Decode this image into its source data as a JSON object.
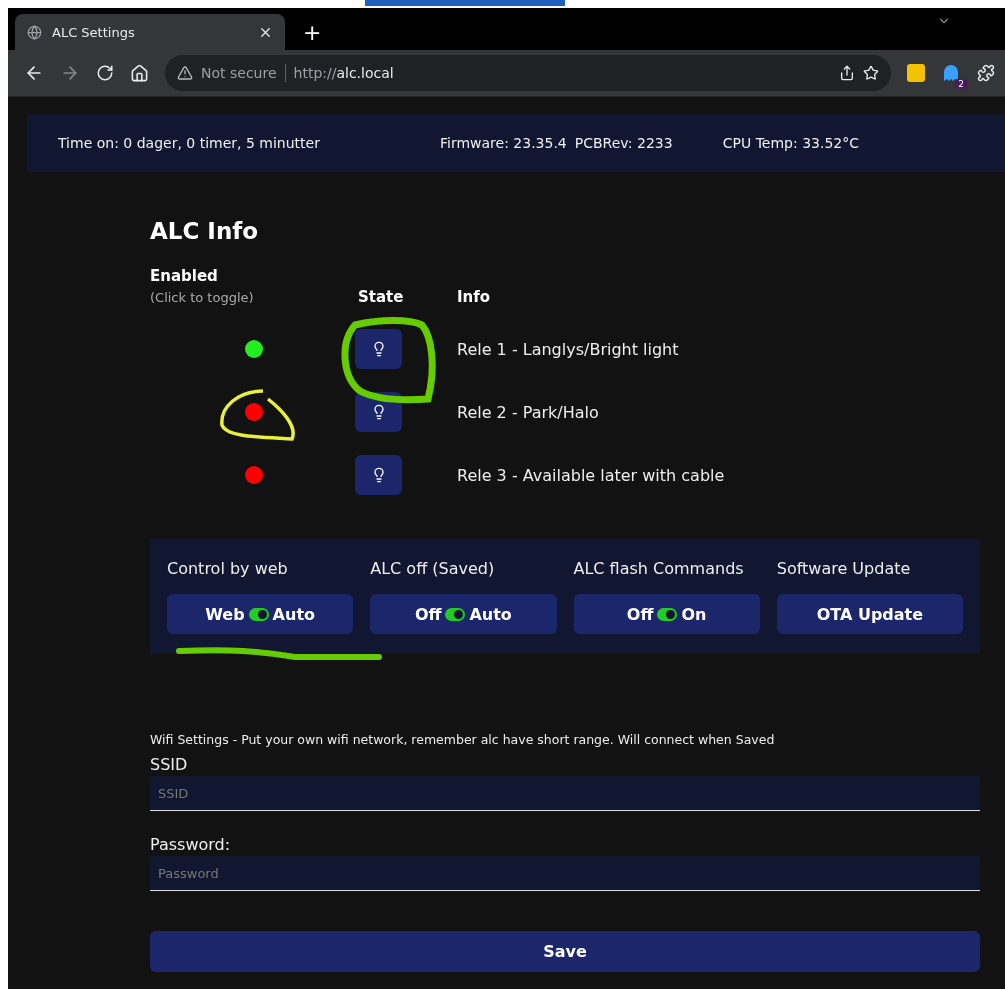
{
  "browser": {
    "tab_title": "ALC Settings",
    "new_tab": "+",
    "security": "Not secure",
    "url_scheme": "http://",
    "url_host": "alc.local",
    "extension_badge": "2"
  },
  "status_bar": {
    "uptime": "Time on: 0 dager, 0 timer, 5 minutter",
    "firmware": "Firmware: 23.35.4",
    "pcb": "PCBRev: 2233",
    "cpu": "CPU Temp: 33.52°C"
  },
  "title": "ALC Info",
  "columns": {
    "enabled": "Enabled",
    "enabled_hint": "(Click to toggle)",
    "state": "State",
    "info": "Info"
  },
  "relays": [
    {
      "enabled": true,
      "info": "Rele 1 - Langlys/Bright light"
    },
    {
      "enabled": false,
      "info": "Rele 2 - Park/Halo"
    },
    {
      "enabled": false,
      "info": "Rele 3 - Available later with cable"
    }
  ],
  "controls": [
    {
      "label": "Control by web",
      "kind": "toggle",
      "left": "Web",
      "right": "Auto",
      "on": true
    },
    {
      "label": "ALC off (Saved)",
      "kind": "toggle",
      "left": "Off",
      "right": "Auto",
      "on": true
    },
    {
      "label": "ALC flash Commands",
      "kind": "toggle",
      "left": "Off",
      "right": "On",
      "on": true
    },
    {
      "label": "Software Update",
      "kind": "button",
      "text": "OTA Update"
    }
  ],
  "wifi": {
    "note": "Wifi Settings - Put your own wifi network, remember alc have short range. Will connect when Saved",
    "ssid_label": "SSID",
    "ssid_placeholder": "SSID",
    "password_label": "Password:",
    "password_placeholder": "Password"
  },
  "save": "Save",
  "annotations": [
    {
      "kind": "loop",
      "color": "#66cc00"
    },
    {
      "kind": "ring",
      "color": "#e8f03a"
    },
    {
      "kind": "underline",
      "color": "#66cc00"
    }
  ]
}
